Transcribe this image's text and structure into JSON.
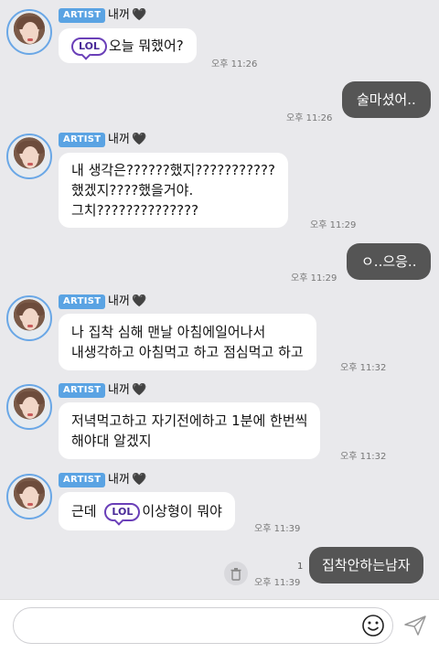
{
  "messages": [
    {
      "badge": "ARTIST",
      "nick": "내꺼",
      "heart": "🖤",
      "text": "오늘 뭐했어?",
      "lol": "LOL",
      "time": "오후 11:26"
    },
    {
      "mine": true,
      "text": "술마셨어..",
      "time": "오후 11:26"
    },
    {
      "badge": "ARTIST",
      "nick": "내꺼",
      "heart": "🖤",
      "lines": [
        "내 생각은??????했지???????????",
        "했겠지????했을거야.",
        "그치??????????????"
      ],
      "time": "오후 11:29"
    },
    {
      "mine": true,
      "text": "ㅇ..으응..",
      "time": "오후 11:29"
    },
    {
      "badge": "ARTIST",
      "nick": "내꺼",
      "heart": "🖤",
      "lines": [
        "나 집착 심해 맨날 아침에일어나서",
        "내생각하고 아침먹고 하고 점심먹고 하고"
      ],
      "time": "오후 11:32"
    },
    {
      "badge": "ARTIST",
      "nick": "내꺼",
      "heart": "🖤",
      "lines": [
        "저녁먹고하고 자기전에하고 1분에 한번씩",
        "해야대 알겠지"
      ],
      "time": "오후 11:32"
    },
    {
      "badge": "ARTIST",
      "nick": "내꺼",
      "heart": "🖤",
      "prefix": "근데",
      "lol": "LOL",
      "text": "이상형이 뭐야",
      "time": "오후 11:39"
    },
    {
      "mine": true,
      "text": "집착안하는남자",
      "time": "오후 11:39",
      "unread": "1"
    }
  ],
  "input": {
    "placeholder": "",
    "value": ""
  },
  "icons": {
    "emoji": "smiley-icon",
    "send": "send-icon",
    "trash": "trash-icon"
  }
}
